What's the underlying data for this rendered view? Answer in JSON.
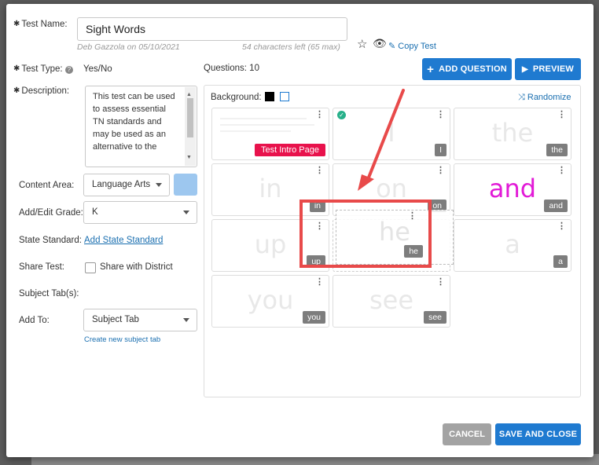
{
  "form": {
    "test_name_label": "Test Name:",
    "test_name_value": "Sight Words",
    "author_line": "Deb Gazzola on 05/10/2021",
    "chars_left": "54 characters left (65 max)",
    "copy_test": "Copy Test",
    "test_type_label": "Test Type:",
    "test_type_value": "Yes/No",
    "description_label": "Description:",
    "description_value": "This test can be used to assess essential TN standards and may be used as an alternative to the",
    "content_area_label": "Content Area:",
    "content_area_value": "Language Arts",
    "grade_label": "Add/Edit Grade:",
    "grade_value": "K",
    "state_standard_label": "State Standard:",
    "state_standard_link": "Add State Standard",
    "share_label": "Share Test:",
    "share_option": "Share with District",
    "subject_tabs_label": "Subject Tab(s):",
    "add_to_label": "Add To:",
    "add_to_value": "Subject Tab",
    "create_tab_link": "Create new subject tab"
  },
  "questions": {
    "count_text": "Questions: 10",
    "add_button": "ADD QUESTION",
    "preview_button": "PREVIEW",
    "background_label": "Background:",
    "randomize": "Randomize",
    "intro_tag": "Test Intro Page",
    "tiles": [
      {
        "word": "",
        "tag": ""
      },
      {
        "word": "I",
        "tag": "I"
      },
      {
        "word": "the",
        "tag": "the"
      },
      {
        "word": "in",
        "tag": "in"
      },
      {
        "word": "on",
        "tag": "on"
      },
      {
        "word": "and",
        "tag": "and"
      },
      {
        "word": "up",
        "tag": "up"
      },
      {
        "word": "a",
        "tag": "a"
      },
      {
        "word": "you",
        "tag": "you"
      },
      {
        "word": "see",
        "tag": "see"
      }
    ],
    "dragged": {
      "word": "he",
      "tag": "he"
    },
    "highlight_color": "#e84a4a",
    "and_color": "#e21ad7"
  },
  "footer": {
    "cancel": "CANCEL",
    "save": "SAVE AND CLOSE"
  },
  "colors": {
    "primary": "#1f7ad0",
    "intro": "#e8124c",
    "annotation": "#e84a4a"
  }
}
